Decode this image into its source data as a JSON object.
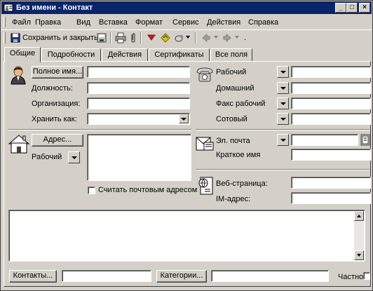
{
  "window": {
    "title": "Без имени - Контакт",
    "controls": {
      "minimize": "_",
      "maximize": "□",
      "close": "×"
    }
  },
  "menu": [
    "Файл",
    "Правка",
    "Вид",
    "Вставка",
    "Формат",
    "Сервис",
    "Действия",
    "Справка"
  ],
  "toolbar": {
    "save_close": "Сохранить и закрыть"
  },
  "tabs": [
    "Общие",
    "Подробности",
    "Действия",
    "Сертификаты",
    "Все поля"
  ],
  "name_section": {
    "full_name_button": "Полное имя...",
    "position_label": "Должность:",
    "organization_label": "Организация:",
    "file_as_label": "Хранить как:"
  },
  "phone_section": {
    "work": "Рабочий",
    "home": "Домашний",
    "fax_work": "Факс рабочий",
    "mobile": "Сотовый"
  },
  "address_section": {
    "address_button": "Адрес...",
    "type": "Рабочий",
    "mailing_checkbox": "Считать почтовым адресом"
  },
  "email_section": {
    "email": "Эл. почта",
    "display_as": "Краткое имя"
  },
  "web_section": {
    "web_page": "Веб-страница:",
    "im_address": "IM-адрес:"
  },
  "footer": {
    "contacts_button": "Контакты...",
    "categories_button": "Категории...",
    "private_label": "Частное"
  }
}
